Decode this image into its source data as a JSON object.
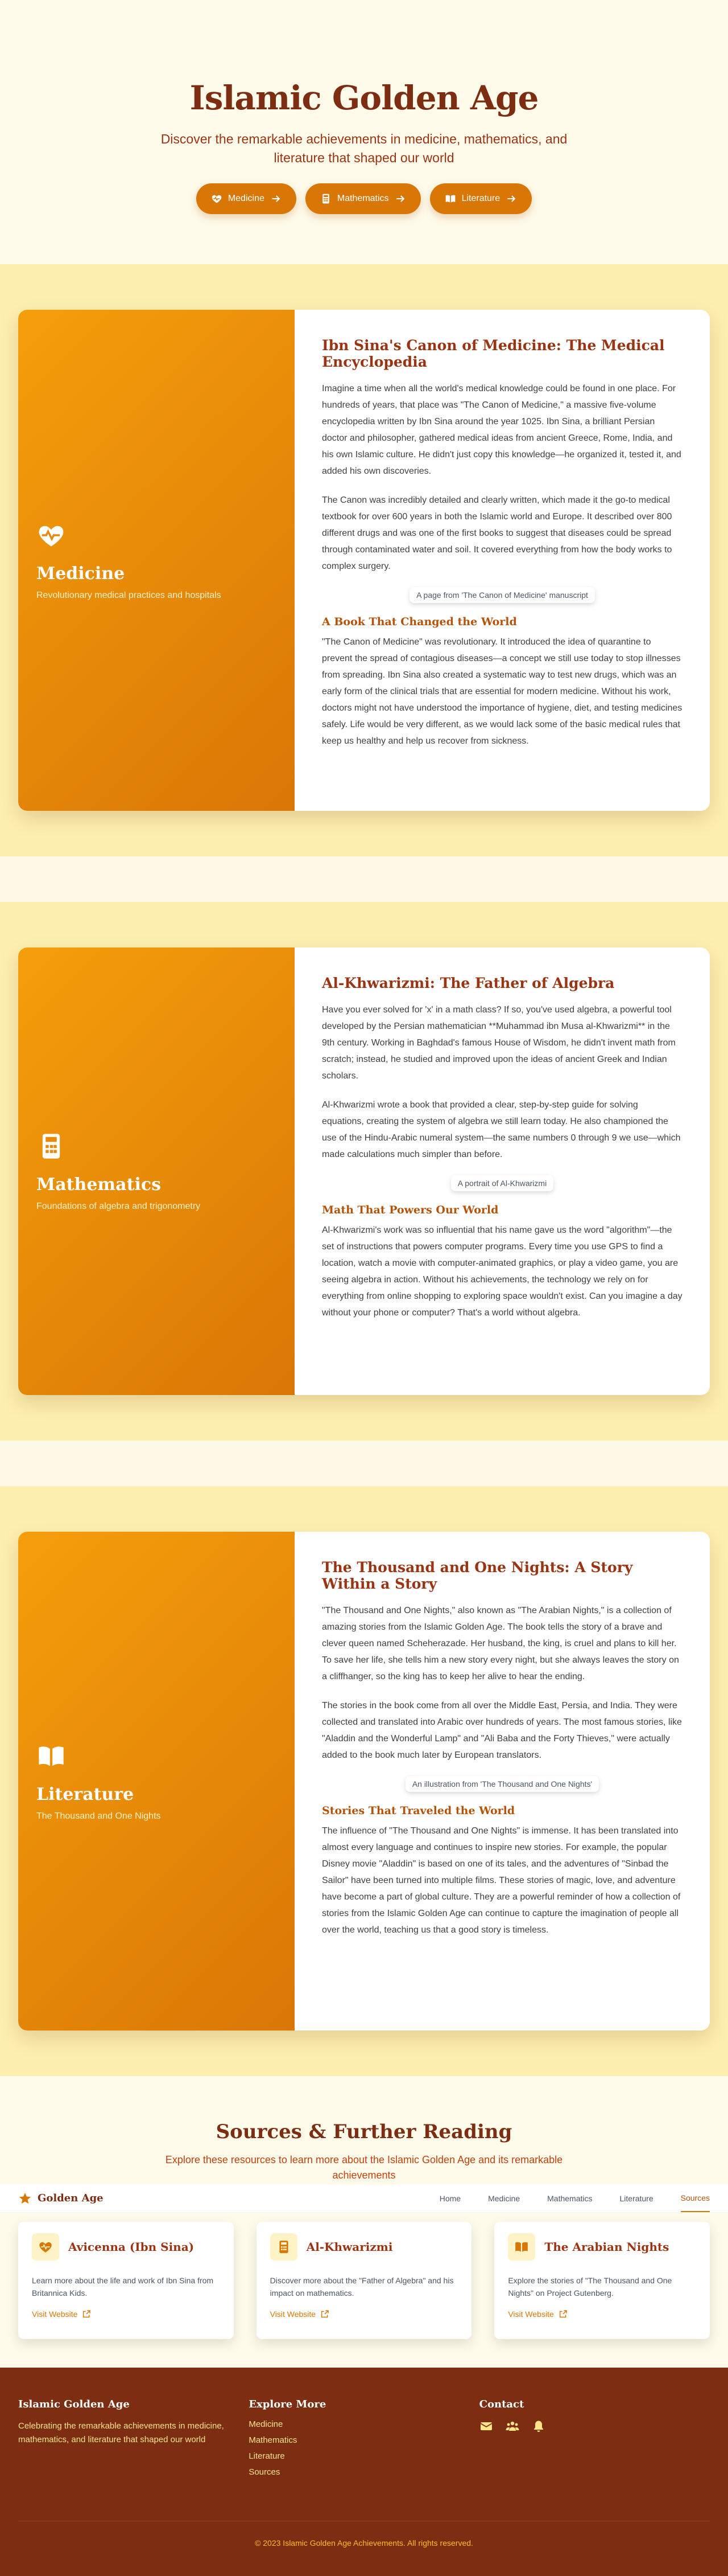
{
  "hero": {
    "title": "Islamic Golden Age",
    "subtitle": "Discover the remarkable achievements in medicine, mathematics, and literature that shaped our world",
    "buttons": [
      {
        "label": "Medicine",
        "icon": "heart-pulse-icon"
      },
      {
        "label": "Mathematics",
        "icon": "calculator-icon"
      },
      {
        "label": "Literature",
        "icon": "book-open-icon"
      }
    ]
  },
  "sections": {
    "medicine": {
      "side_title": "Medicine",
      "side_subtitle": "Revolutionary medical practices and hospitals",
      "title": "Ibn Sina's Canon of Medicine: The Medical Encyclopedia",
      "p1": "Imagine a time when all the world's medical knowledge could be found in one place. For hundreds of years, that place was \"The Canon of Medicine,\" a massive five-volume encyclopedia written by Ibn Sina around the year 1025. Ibn Sina, a brilliant Persian doctor and philosopher, gathered medical ideas from ancient Greece, Rome, India, and his own Islamic culture. He didn't just copy this knowledge—he organized it, tested it, and added his own discoveries.",
      "p2": "The Canon was incredibly detailed and clearly written, which made it the go-to medical textbook for over 600 years in both the Islamic world and Europe. It described over 800 different drugs and was one of the first books to suggest that diseases could be spread through contaminated water and soil. It covered everything from how the body works to complex surgery.",
      "image_alt": "A page from 'The Canon of Medicine' manuscript",
      "subheading": "A Book That Changed the World",
      "p3": "\"The Canon of Medicine\" was revolutionary. It introduced the idea of quarantine to prevent the spread of contagious diseases—a concept we still use today to stop illnesses from spreading. Ibn Sina also created a systematic way to test new drugs, which was an early form of the clinical trials that are essential for modern medicine. Without his work, doctors might not have understood the importance of hygiene, diet, and testing medicines safely. Life would be very different, as we would lack some of the basic medical rules that keep us healthy and help us recover from sickness."
    },
    "mathematics": {
      "side_title": "Mathematics",
      "side_subtitle": "Foundations of algebra and trigonometry",
      "title": "Al-Khwarizmi: The Father of Algebra",
      "p1": "Have you ever solved for 'x' in a math class? If so, you've used algebra, a powerful tool developed by the Persian mathematician **Muhammad ibn Musa al-Khwarizmi** in the 9th century. Working in Baghdad's famous House of Wisdom, he didn't invent math from scratch; instead, he studied and improved upon the ideas of ancient Greek and Indian scholars.",
      "p2": "Al-Khwarizmi wrote a book that provided a clear, step-by-step guide for solving equations, creating the system of algebra we still learn today. He also championed the use of the Hindu-Arabic numeral system—the same numbers 0 through 9 we use—which made calculations much simpler than before.",
      "image_alt": "A portrait of Al-Khwarizmi",
      "subheading": "Math That Powers Our World",
      "p3": "Al-Khwarizmi's work was so influential that his name gave us the word \"algorithm\"—the set of instructions that powers computer programs. Every time you use GPS to find a location, watch a movie with computer-animated graphics, or play a video game, you are seeing algebra in action. Without his achievements, the technology we rely on for everything from online shopping to exploring space wouldn't exist. Can you imagine a day without your phone or computer? That's a world without algebra."
    },
    "literature": {
      "side_title": "Literature",
      "side_subtitle": "The Thousand and One Nights",
      "title": "The Thousand and One Nights: A Story Within a Story",
      "p1": "\"The Thousand and One Nights,\" also known as \"The Arabian Nights,\" is a collection of amazing stories from the Islamic Golden Age. The book tells the story of a brave and clever queen named Scheherazade. Her husband, the king, is cruel and plans to kill her. To save her life, she tells him a new story every night, but she always leaves the story on a cliffhanger, so the king has to keep her alive to hear the ending.",
      "p2": "The stories in the book come from all over the Middle East, Persia, and India. They were collected and translated into Arabic over hundreds of years. The most famous stories, like \"Aladdin and the Wonderful Lamp\" and \"Ali Baba and the Forty Thieves,\" were actually added to the book much later by European translators.",
      "image_alt": "An illustration from 'The Thousand and One Nights'",
      "subheading": "Stories That Traveled the World",
      "p3": "The influence of \"The Thousand and One Nights\" is immense. It has been translated into almost every language and continues to inspire new stories. For example, the popular Disney movie \"Aladdin\" is based on one of its tales, and the adventures of \"Sinbad the Sailor\" have been turned into multiple films. These stories of magic, love, and adventure have become a part of global culture. They are a powerful reminder of how a collection of stories from the Islamic Golden Age can continue to capture the imagination of people all over the world, teaching us that a good story is timeless."
    }
  },
  "sources": {
    "title": "Sources & Further Reading",
    "subtitle": "Explore these resources to learn more about the Islamic Golden Age and its remarkable achievements",
    "cards": [
      {
        "title": "Avicenna (Ibn Sina)",
        "text": "Learn more about the life and work of Ibn Sina from Britannica Kids.",
        "link": "Visit Website",
        "icon": "heart-pulse-icon"
      },
      {
        "title": "Al-Khwarizmi",
        "text": "Discover more about the \"Father of Algebra\" and his impact on mathematics.",
        "link": "Visit Website",
        "icon": "calculator-icon"
      },
      {
        "title": "The Arabian Nights",
        "text": "Explore the stories of \"The Thousand and One Nights\" on Project Gutenberg.",
        "link": "Visit Website",
        "icon": "book-open-icon"
      }
    ]
  },
  "navbar": {
    "brand": "Golden Age",
    "links": [
      "Home",
      "Medicine",
      "Mathematics",
      "Literature",
      "Sources"
    ],
    "active": "Sources"
  },
  "footer": {
    "about_title": "Islamic Golden Age",
    "about_text": "Celebrating the remarkable achievements in medicine, mathematics, and literature that shaped our world",
    "explore_title": "Explore More",
    "explore_links": [
      "Medicine",
      "Mathematics",
      "Literature",
      "Sources"
    ],
    "contact_title": "Contact",
    "contact_icons": [
      "envelope-icon",
      "users-icon",
      "bell-icon"
    ],
    "copyright": "© 2023 Islamic Golden Age Achievements. All rights reserved."
  },
  "colors": {
    "accent": "#d97706",
    "brand_dark": "#7c2d12",
    "section_bg": "#fdefaf"
  }
}
